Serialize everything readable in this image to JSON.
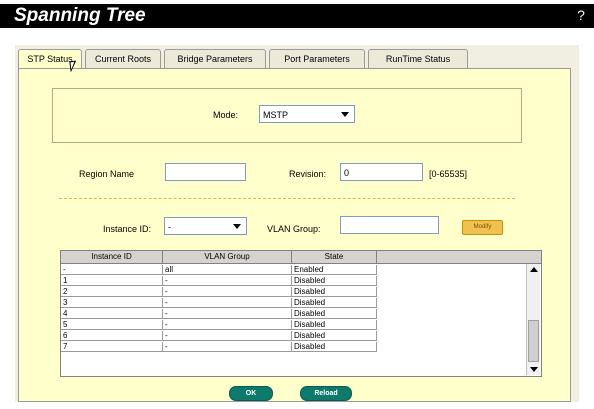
{
  "header": {
    "title": "Spanning Tree",
    "help_glyph": "?"
  },
  "tabs": [
    {
      "label": "STP Status",
      "active": true
    },
    {
      "label": "Current Roots",
      "active": false
    },
    {
      "label": "Bridge Parameters",
      "active": false
    },
    {
      "label": "Port Parameters",
      "active": false
    },
    {
      "label": "RunTime Status",
      "active": false
    }
  ],
  "mode": {
    "label": "Mode:",
    "value": "MSTP"
  },
  "region": {
    "label": "Region Name",
    "value": ""
  },
  "revision": {
    "label": "Revision:",
    "value": "0",
    "hint": "[0-65535]"
  },
  "instance": {
    "label": "Instance ID:",
    "value": "-"
  },
  "vlan_group": {
    "label": "VLAN Group:",
    "value": ""
  },
  "modify_label": "Modify",
  "table": {
    "headers": [
      "Instance ID",
      "VLAN Group",
      "State"
    ],
    "rows": [
      [
        "-",
        "all",
        "Enabled"
      ],
      [
        "1",
        "-",
        "Disabled"
      ],
      [
        "2",
        "-",
        "Disabled"
      ],
      [
        "3",
        "-",
        "Disabled"
      ],
      [
        "4",
        "-",
        "Disabled"
      ],
      [
        "5",
        "-",
        "Disabled"
      ],
      [
        "6",
        "-",
        "Disabled"
      ],
      [
        "7",
        "-",
        "Disabled"
      ]
    ]
  },
  "buttons": {
    "ok": "OK",
    "reload": "Reload"
  },
  "colors": {
    "title_bar": "#000000",
    "panel_bg": "#ffffcc",
    "button": "#0e7a6b",
    "modify": "#f0c050"
  }
}
